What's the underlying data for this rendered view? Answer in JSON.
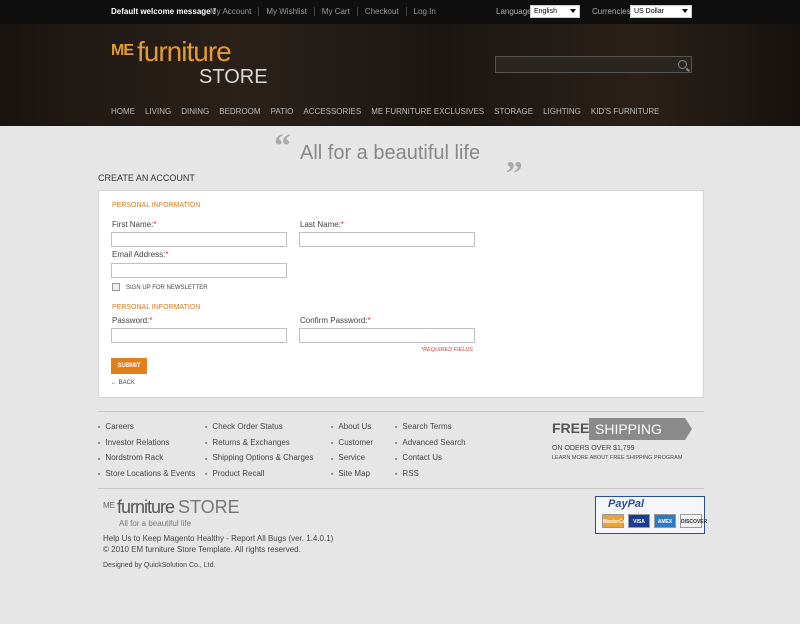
{
  "topbar": {
    "welcome": "Default welcome message !",
    "links": [
      "My Account",
      "My Wishlist",
      "My Cart",
      "Checkout",
      "Log In"
    ],
    "language_label": "Language",
    "language_value": "English",
    "currency_label": "Currencies",
    "currency_value": "US Dollar"
  },
  "header": {
    "logo_me": "ME",
    "logo_furniture": "furniture",
    "logo_store": "STORE",
    "nav": [
      "HOME",
      "LIVING",
      "DINING",
      "BEDROOM",
      "PATIO",
      "ACCESSORIES",
      "ME FURNITURE EXCLUSIVES",
      "STORAGE",
      "LIGHTING",
      "KID'S FURNITURE"
    ]
  },
  "tagline": {
    "open_quote": "“",
    "text": "All for a beautiful life",
    "close_quote": "„"
  },
  "page_title": "CREATE AN ACCOUNT",
  "form": {
    "section1": "PERSONAL INFORMATION",
    "first_name": "First Name:",
    "last_name": "Last Name:",
    "email": "Email Address:",
    "required_mark": "*",
    "newsletter": "SIGN UP FOR NEWSLETTER",
    "section2": "PERSONAL INFORMATION",
    "password": "Password:",
    "confirm_password": "Confirm Password:",
    "required_fields": "*REQUIRED FIELDS",
    "submit": "SUBMIT",
    "back": "← BACK"
  },
  "footer": {
    "col1": [
      "Careers",
      "Investor Relations",
      "Nordstrom Rack",
      "Store Locations & Events"
    ],
    "col2": [
      "Check Order Status",
      "Returns & Exchanges",
      "Shipping Options & Charges",
      "Product Recall"
    ],
    "col3": [
      "About Us",
      "Customer",
      "Service",
      "Site Map"
    ],
    "col4": [
      "Search Terms",
      "Advanced Search",
      "Contact Us",
      "RSS"
    ],
    "shipping_free": "FREE",
    "shipping_word": "SHIPPING",
    "shipping_line1": "ON ODERS OVER $1,799",
    "shipping_line2": "LEARN MORE ABOUT FREE SHIPPING PROGRAM"
  },
  "bottom": {
    "logo_me": "ME",
    "logo_furniture": "furniture",
    "logo_store": "STORE",
    "logo_tagline": "All for a beautiful life",
    "help": "Help Us to Keep Magento Healthy - Report All Bugs (ver. 1.4.0.1)",
    "copyright": "© 2010 EM furniture Store Template. All rights reserved.",
    "designed": "Designed by QuickSolution Co., Ltd.",
    "paypal": "PayPal",
    "cards": [
      "MasterCard",
      "VISA",
      "AMEX",
      "DISCOVER"
    ]
  },
  "colors": {
    "accent": "#e2811c",
    "header_bg": "#1a1410",
    "page_bg": "#e6e6e6"
  }
}
